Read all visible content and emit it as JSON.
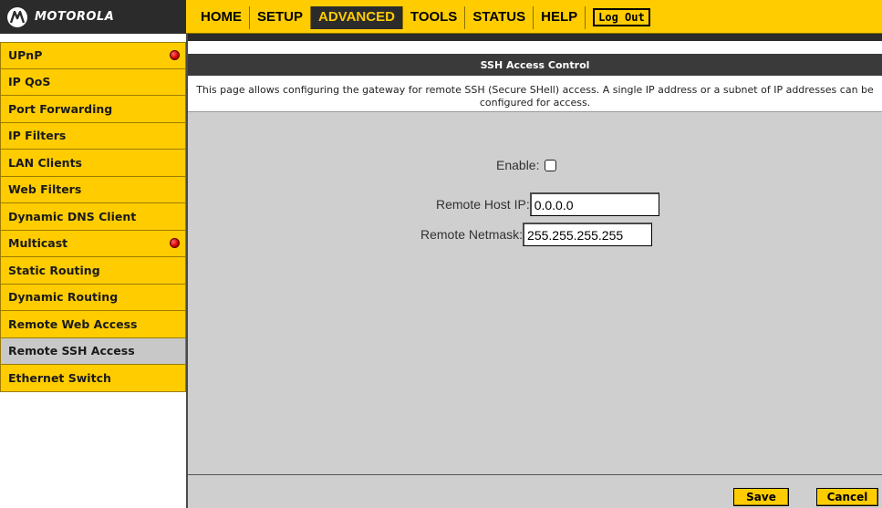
{
  "brand": {
    "name": "MOTOROLA",
    "logo_icon": "motorola-m-logo"
  },
  "nav": [
    {
      "label": "HOME",
      "active": false
    },
    {
      "label": "SETUP",
      "active": false
    },
    {
      "label": "ADVANCED",
      "active": true
    },
    {
      "label": "TOOLS",
      "active": false
    },
    {
      "label": "STATUS",
      "active": false
    },
    {
      "label": "HELP",
      "active": false
    }
  ],
  "logout_label": "Log Out",
  "sidebar": {
    "items": [
      {
        "label": "UPnP",
        "has_dot": true,
        "selected": false
      },
      {
        "label": "IP QoS",
        "has_dot": false,
        "selected": false
      },
      {
        "label": "Port Forwarding",
        "has_dot": false,
        "selected": false
      },
      {
        "label": "IP Filters",
        "has_dot": false,
        "selected": false
      },
      {
        "label": "LAN Clients",
        "has_dot": false,
        "selected": false
      },
      {
        "label": "Web Filters",
        "has_dot": false,
        "selected": false
      },
      {
        "label": "Dynamic DNS Client",
        "has_dot": false,
        "selected": false
      },
      {
        "label": "Multicast",
        "has_dot": true,
        "selected": false
      },
      {
        "label": "Static Routing",
        "has_dot": false,
        "selected": false
      },
      {
        "label": "Dynamic Routing",
        "has_dot": false,
        "selected": false
      },
      {
        "label": "Remote Web Access",
        "has_dot": false,
        "selected": false
      },
      {
        "label": "Remote SSH Access",
        "has_dot": false,
        "selected": true
      },
      {
        "label": "Ethernet Switch",
        "has_dot": false,
        "selected": false
      }
    ]
  },
  "page": {
    "title": "SSH Access Control",
    "description": "This page allows configuring the gateway for remote SSH (Secure SHell) access. A single IP address or a subnet of IP addresses can be configured for access."
  },
  "form": {
    "enable_label": "Enable:",
    "enable_checked": false,
    "remote_host_label": "Remote Host IP:",
    "remote_host_value": "0.0.0.0",
    "remote_netmask_label": "Remote Netmask:",
    "remote_netmask_value": "255.255.255.255"
  },
  "buttons": {
    "save": "Save",
    "cancel": "Cancel"
  },
  "colors": {
    "accent": "#ffcc00",
    "dark": "#2b2b2b",
    "panel": "#cfcfcf",
    "selected": "#c8c8c8",
    "status_dot": "#d60000"
  }
}
